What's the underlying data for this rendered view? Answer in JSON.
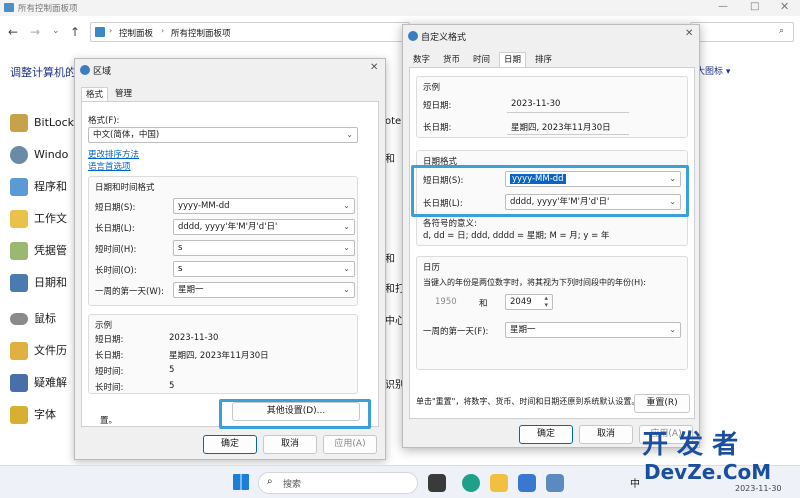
{
  "main_window": {
    "title": "所有控制面板项",
    "breadcrumb": [
      "控制面板",
      "所有控制面板项"
    ],
    "search_placeholder": "",
    "heading": "调整计算机的",
    "view_label": "大图标",
    "items_left": [
      "BitLock",
      "Windo",
      "程序和",
      "工作文",
      "凭据管",
      "日期和",
      "鼠标",
      "文件历",
      "疑难解",
      "字体"
    ],
    "items_right": [
      "ote",
      "和",
      "和",
      "和打",
      "中心",
      "识别"
    ]
  },
  "region_dialog": {
    "title": "区域",
    "tabs": [
      "格式",
      "管理"
    ],
    "format_label": "格式(F):",
    "format_value": "中文(简体，中国)",
    "sort_link": "更改排序方法",
    "lang_link": "语言首选项",
    "datetime_group": "日期和时间格式",
    "rows": [
      {
        "label": "短日期(S):",
        "value": "yyyy-MM-dd"
      },
      {
        "label": "长日期(L):",
        "value": "dddd, yyyy'年'M'月'd'日'"
      },
      {
        "label": "短时间(H):",
        "value": "s"
      },
      {
        "label": "长时间(O):",
        "value": "s"
      },
      {
        "label": "一周的第一天(W):",
        "value": "星期一"
      }
    ],
    "example_group": "示例",
    "examples": [
      {
        "label": "短日期:",
        "value": "2023-11-30"
      },
      {
        "label": "长日期:",
        "value": "星期四, 2023年11月30日"
      },
      {
        "label": "短时间:",
        "value": "5"
      },
      {
        "label": "长时间:",
        "value": "5"
      }
    ],
    "footer_note": "置。",
    "other_settings": "其他设置(D)...",
    "ok": "确定",
    "cancel": "取消",
    "apply": "应用(A)"
  },
  "custom_dialog": {
    "title": "自定义格式",
    "tabs": [
      "数字",
      "货币",
      "时间",
      "日期",
      "排序"
    ],
    "example_group": "示例",
    "examples": [
      {
        "label": "短日期:",
        "value": "2023-11-30"
      },
      {
        "label": "长日期:",
        "value": "星期四, 2023年11月30日"
      }
    ],
    "format_group": "日期格式",
    "formats": [
      {
        "label": "短日期(S):",
        "value": "yyyy-MM-dd"
      },
      {
        "label": "长日期(L):",
        "value": "dddd, yyyy'年'M'月'd'日'"
      }
    ],
    "meaning_title": "各符号的意义:",
    "meaning_text": "d, dd = 日;  ddd, dddd = 星期;  M = 月;  y = 年",
    "calendar_group": "日历",
    "calendar_text": "当键入的年份是两位数字时，将其视为下列时间段中的年份(H):",
    "year_from": "1950",
    "year_and": "和",
    "year_to": "2049",
    "first_day_label": "一周的第一天(F):",
    "first_day_value": "星期一",
    "reset_text": "单击\"重置\"，将数字、货币、时间和日期还原到系统默认设置。",
    "reset": "重置(R)",
    "ok": "确定",
    "cancel": "取消",
    "apply": "应用(A)"
  },
  "taskbar": {
    "search": "搜索",
    "ime": "中",
    "date": "2023-11-30"
  },
  "watermark": {
    "line1": "开 发 者",
    "line2": "DevZe.CoM"
  }
}
